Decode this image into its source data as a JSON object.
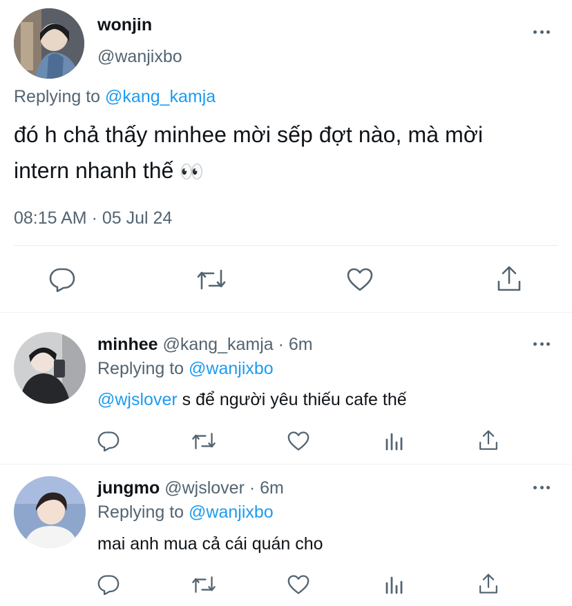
{
  "main_tweet": {
    "display_name": "wonjin",
    "handle": "@wanjixbo",
    "replying_prefix": "Replying to",
    "replying_to": "@kang_kamja",
    "text_line1": "đó h chả thấy minhee mời sếp đợt nào, mà mời",
    "text_line2": "intern nhanh thế",
    "emoji": "👀",
    "timestamp": "08:15 AM · 05 Jul 24"
  },
  "replies": [
    {
      "display_name": "minhee",
      "handle_time": "@kang_kamja · 6m",
      "replying_prefix": "Replying to",
      "replying_to": "@wanjixbo",
      "mention": "@wjslover",
      "text": " s để người yêu thiếu cafe thế"
    },
    {
      "display_name": "jungmo",
      "handle_time": "@wjslover · 6m",
      "replying_prefix": "Replying to",
      "replying_to": "@wanjixbo",
      "mention": "",
      "text": "mai anh mua cả cái quán cho"
    }
  ],
  "icons": {
    "reply": "reply-icon",
    "retweet": "retweet-icon",
    "like": "heart-icon",
    "views": "views-icon",
    "share": "share-icon",
    "more": "more-icon"
  },
  "colors": {
    "link": "#1d9bf0",
    "muted": "#536471",
    "text": "#0f1419",
    "divider": "#e6ecf0"
  }
}
